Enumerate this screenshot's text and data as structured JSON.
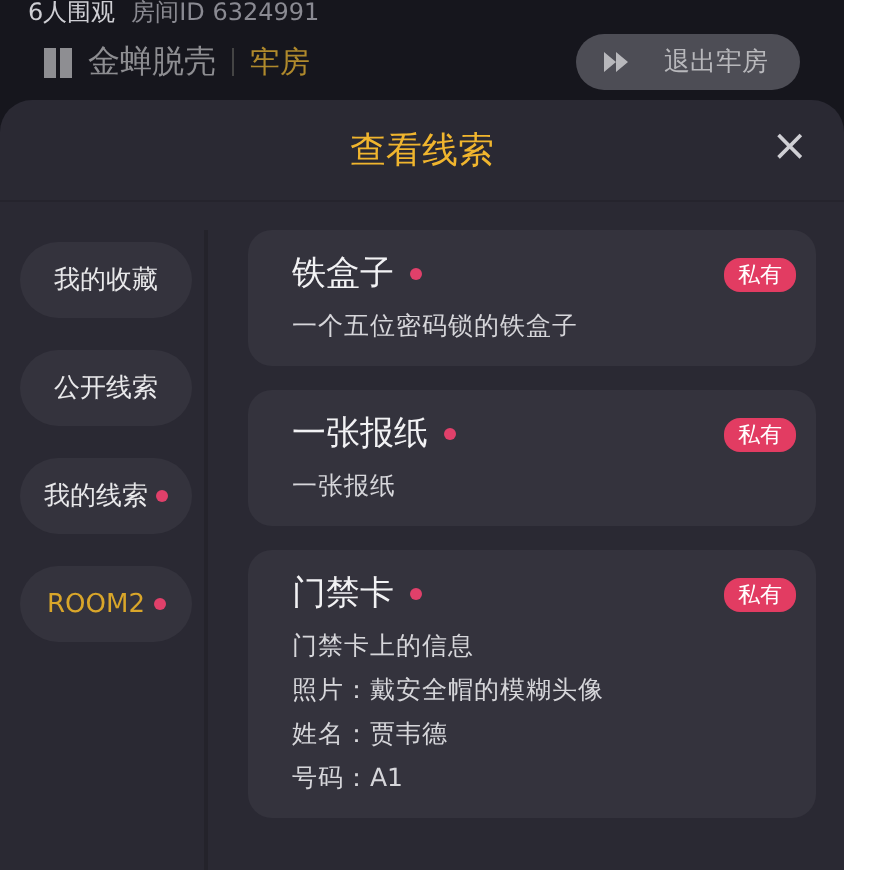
{
  "top_bar": {
    "viewers": "6人围观",
    "room_id": "房间ID 6324991"
  },
  "sub_bar": {
    "game": "金蝉脱壳",
    "location": "牢房",
    "exit_button": "退出牢房"
  },
  "dialog": {
    "title": "查看线索",
    "close": "×",
    "sidebar": [
      {
        "label": "我的收藏",
        "selected": false,
        "dot": false
      },
      {
        "label": "公开线索",
        "selected": false,
        "dot": false
      },
      {
        "label": "我的线索",
        "selected": false,
        "dot": true
      },
      {
        "label": "ROOM2",
        "selected": true,
        "dot": true
      }
    ],
    "clues": [
      {
        "title": "铁盒子",
        "unread": true,
        "badge": "私有",
        "lines": [
          "一个五位密码锁的铁盒子"
        ]
      },
      {
        "title": "一张报纸",
        "unread": true,
        "badge": "私有",
        "lines": [
          "一张报纸"
        ]
      },
      {
        "title": "门禁卡",
        "unread": true,
        "badge": "私有",
        "lines": [
          "门禁卡上的信息",
          "照片：戴安全帽的模糊头像",
          "姓名：贾韦德",
          "号码：A1"
        ]
      }
    ]
  }
}
